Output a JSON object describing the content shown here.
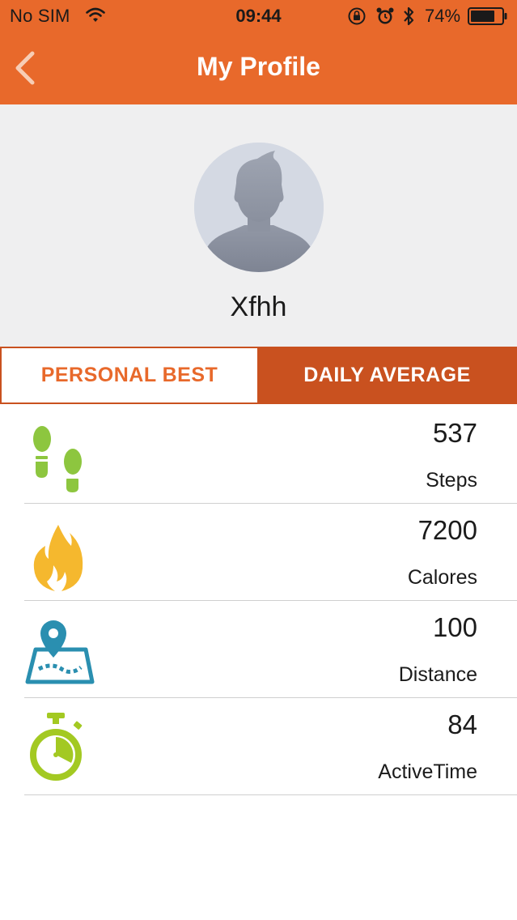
{
  "status_bar": {
    "carrier": "No SIM",
    "time": "09:44",
    "battery_percent": "74%"
  },
  "nav": {
    "title": "My Profile",
    "back_icon": "chevron-left-icon"
  },
  "profile": {
    "username": "Xfhh",
    "avatar_icon": "default-user-avatar"
  },
  "tabs": [
    {
      "label": "PERSONAL BEST",
      "selected": true
    },
    {
      "label": "DAILY AVERAGE",
      "selected": false
    }
  ],
  "stats": [
    {
      "value": "537",
      "label": "Steps",
      "icon": "footprints-icon",
      "color": "#8DC63F"
    },
    {
      "value": "7200",
      "label": "Calores",
      "icon": "flame-icon",
      "color": "#F5B82E"
    },
    {
      "value": "100",
      "label": "Distance",
      "icon": "map-pin-icon",
      "color": "#2A8FB0"
    },
    {
      "value": "84",
      "label": "ActiveTime",
      "icon": "stopwatch-icon",
      "color": "#A3C922"
    }
  ],
  "colors": {
    "header": "#E8692B",
    "tab_active_bg": "#C9511F",
    "profile_bg": "#EFEFF0"
  }
}
